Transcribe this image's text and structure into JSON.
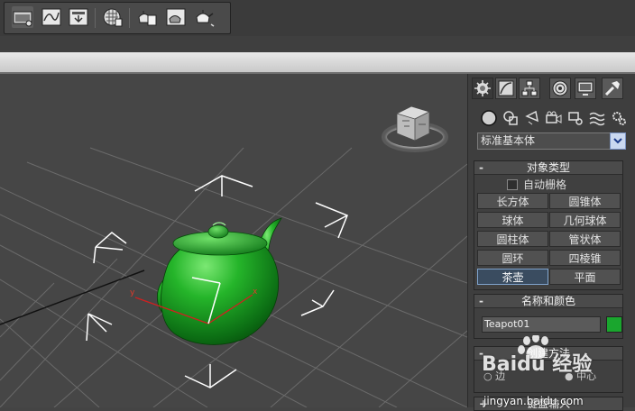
{
  "command_panel": {
    "category_dropdown": "标准基本体",
    "object_type": {
      "title": "对象类型",
      "autogrid_label": "自动栅格",
      "buttons": [
        "长方体",
        "圆锥体",
        "球体",
        "几何球体",
        "圆柱体",
        "管状体",
        "圆环",
        "四棱锥",
        "茶壶",
        "平面"
      ],
      "active_button": "茶壶"
    },
    "name_color": {
      "title": "名称和颜色",
      "name_value": "Teapot01",
      "color": "#1aa62e"
    },
    "creation_method": {
      "title": "创建方法",
      "options": [
        "边",
        "中心"
      ]
    },
    "keyboard_entry": {
      "title": "键盘输入"
    }
  },
  "viewport": {
    "axis_x_label": "x",
    "axis_y_label": "y",
    "object_color": "#1fae2c"
  },
  "watermark": {
    "brand": "Baidu 经验",
    "url": "jingyan.baidu.com"
  }
}
